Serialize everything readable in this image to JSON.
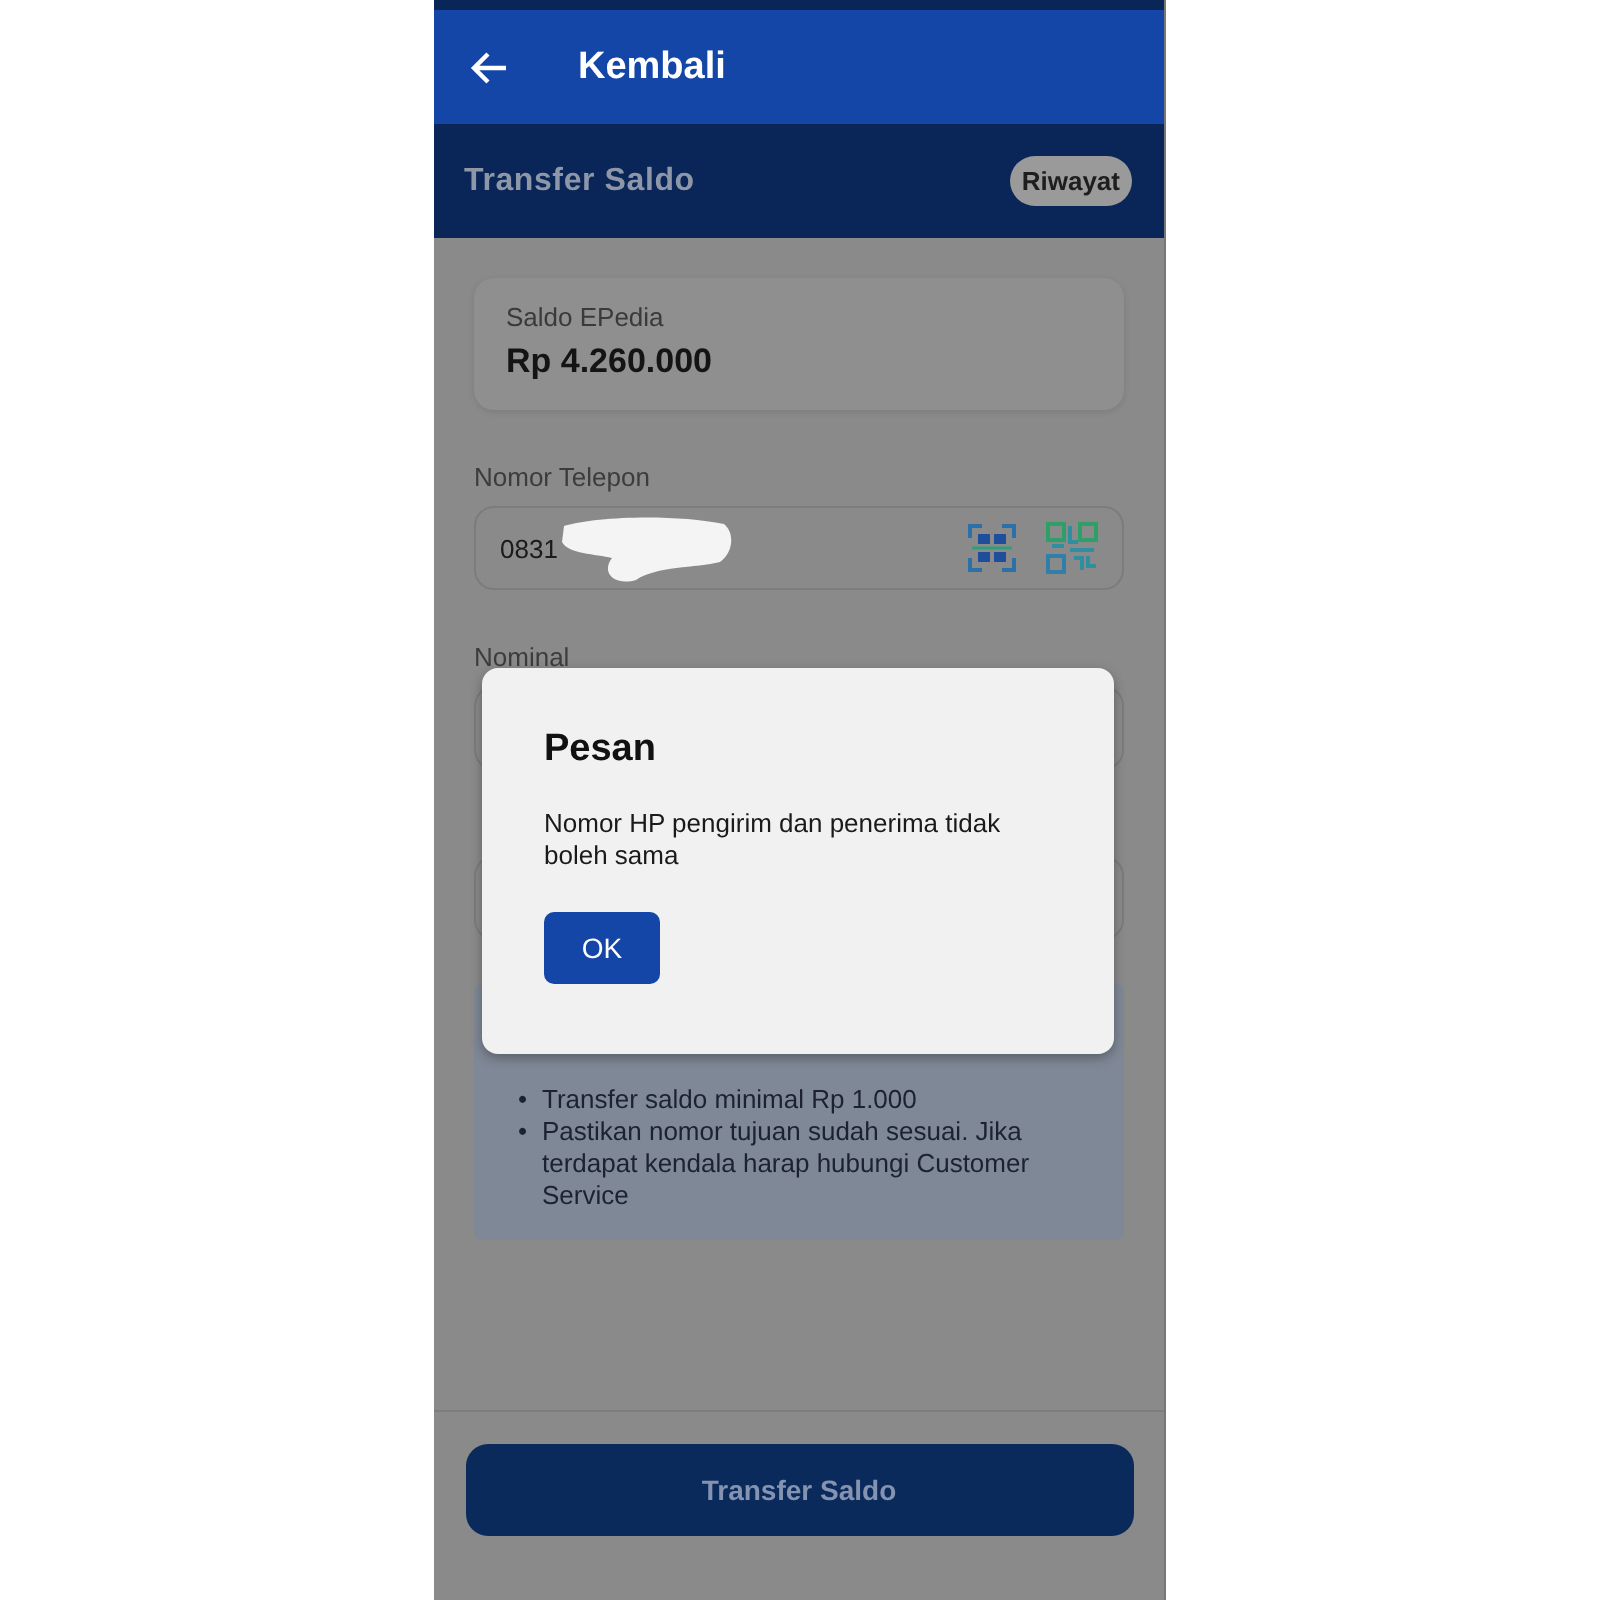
{
  "app_bar": {
    "title": "Kembali"
  },
  "sub_header": {
    "title": "Transfer Saldo",
    "history_button": "Riwayat"
  },
  "balance_card": {
    "label": "Saldo EPedia",
    "amount": "Rp 4.260.000"
  },
  "phone_field": {
    "label": "Nomor Telepon",
    "value": "0831"
  },
  "nominal_field": {
    "label": "Nominal"
  },
  "info_box": {
    "items": [
      {
        "bullet": "•",
        "text": "Transfer saldo minimal Rp 1.000"
      },
      {
        "bullet": "•",
        "text": "Pastikan nomor tujuan sudah sesuai. Jika terdapat kendala harap hubungi Customer Service"
      }
    ]
  },
  "dialog": {
    "title": "Pesan",
    "message": "Nomor HP pengirim dan penerima tidak boleh sama",
    "button": "OK"
  },
  "submit_button": "Transfer Saldo"
}
